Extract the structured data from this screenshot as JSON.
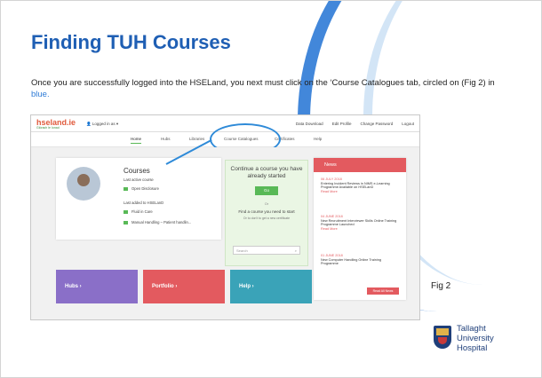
{
  "slide": {
    "title": "Finding TUH Courses",
    "intro_main": "Once you are successfully logged into the HSELand, you next must click on the ‘Course Catalogues tab, circled on (Fig 2) in ",
    "intro_blue": "blue.",
    "fig_label": "Fig 2",
    "logo_lines": [
      "Tallaght",
      "University",
      "Hospital"
    ]
  },
  "hseland": {
    "logo": "hseland.ie",
    "logo_sub": "Glórach le Ionad",
    "user": "Logged in as",
    "top_links": [
      "Data Download",
      "Edit Profile",
      "Change Password",
      "Logout"
    ],
    "nav": [
      "Home",
      "Hubs",
      "Libraries",
      "Course Catalogues",
      "Certificates",
      "Help"
    ],
    "courses": {
      "title": "Courses",
      "last_active_label": "Last active course",
      "last_active_item": "Open Disclosure",
      "last_added_label": "Last added to HSELanD",
      "added_items": [
        "Fluid in Care",
        "Manual Handling – Patient handlin..."
      ]
    },
    "continue": {
      "heading": "Continue a course you have already started",
      "go": "Go",
      "or": "Or",
      "find": "Find a course you need to start",
      "find_sub": "Or to don't to get a new certificate",
      "search_placeholder": "Search"
    },
    "news": {
      "heading": "News",
      "items": [
        {
          "date": "06 JULY 2018",
          "text": "Entering Incident Reviews in NIMS e-Learning Programme Available on HSELanD",
          "more": "Read More"
        },
        {
          "date": "04 JUNE 2018",
          "text": "New Recruitment Interviewer Skills Online Training Programme Launched",
          "more": "Read More"
        },
        {
          "date": "01 JUNE 2018",
          "text": "New Computer Handling Online Training Programme",
          "more": ""
        }
      ],
      "view_all": "Read All News"
    },
    "tiles": [
      "Hubs",
      "Portfolio",
      "Help"
    ]
  },
  "colors": {
    "title": "#1f5fb4",
    "highlight_circle": "#2e8ad8",
    "news": "#e35a5f",
    "green": "#59b957"
  }
}
